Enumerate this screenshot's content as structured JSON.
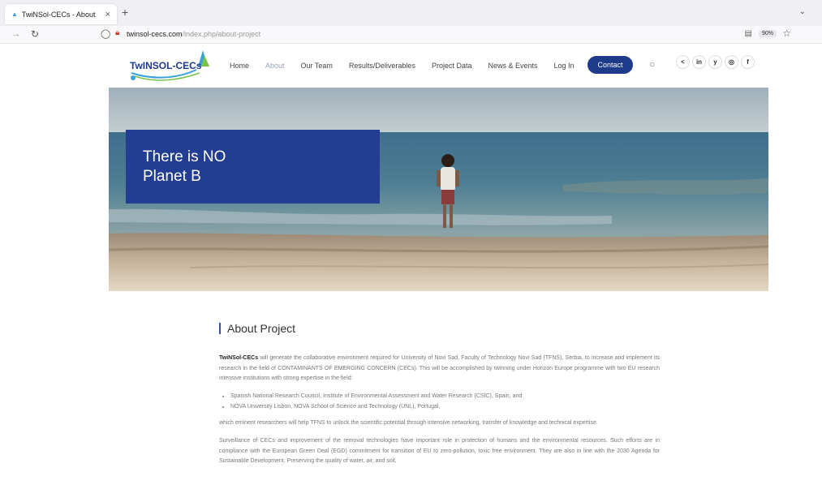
{
  "browser": {
    "tab_title": "TwiNSol-CECs - About",
    "tab_close": "×",
    "new_tab": "+",
    "url_domain": "twinsol-cecs.com",
    "url_path": "/index.php/about-project",
    "zoom": "90%"
  },
  "site": {
    "logo_text": "TwINSOL-CECs",
    "nav": [
      {
        "label": "Home"
      },
      {
        "label": "About"
      },
      {
        "label": "Our Team"
      },
      {
        "label": "Results/Deliverables"
      },
      {
        "label": "Project Data"
      },
      {
        "label": "News & Events"
      },
      {
        "label": "Log In"
      }
    ],
    "contact_label": "Contact",
    "social": [
      "<",
      "in",
      "y",
      "◎",
      "f"
    ]
  },
  "hero": {
    "line1": "There is NO",
    "line2": "Planet B"
  },
  "content": {
    "heading": "About Project",
    "p1_bold": "TwiNSol-CECs",
    "p1_rest": " will generate the collaborative environment required for University of Novi Sad, Faculty of Technology Novi Sad (TFNS), Serbia, to increase and implement its research in the field of CONTAMINANTS OF EMERGING CONCERN (CECs). This will be accomplished by twinning under Horizon Europe programme with two EU research intensive institutions with strong expertise in the field:",
    "bullets": [
      "Spanish National Research Council, Institute of Environmental Assessment and Water Research (CSIC), Spain, and",
      "NOVA University Lisbon, NOVA School of Science and Technology (UNL), Portugal,"
    ],
    "p2": "which eminent researchers will help TFNS to unlock the scientific potential through intensive networking, transfer of knowledge and technical expertise.",
    "p3": "Surveillance of CECs and improvement of the removal technologies have important role in protection of humans and the environmental resources. Such efforts are in compliance with the European Green Deal (EGD) commitment for transition of EU to zero-pollution, toxic free environment. They are also in line with the 2030 Agenda for Sustainable Development. Preserving the quality of water, air, and soil,"
  }
}
